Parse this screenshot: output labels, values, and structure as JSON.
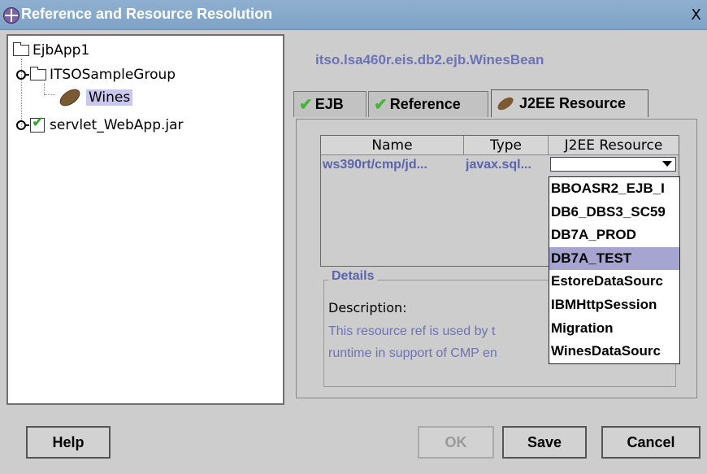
{
  "window": {
    "title": "Reference and Resource Resolution",
    "close_label": "X"
  },
  "tree": {
    "items": [
      {
        "label": "EjbApp1"
      },
      {
        "label": "ITSOSampleGroup"
      },
      {
        "label": "Wines"
      },
      {
        "label": "servlet_WebApp.jar"
      }
    ]
  },
  "bean_name": "itso.lsa460r.eis.db2.ejb.WinesBean",
  "tabs": [
    {
      "label": "EJB"
    },
    {
      "label": "Reference"
    },
    {
      "label": "J2EE Resource"
    }
  ],
  "table": {
    "columns": [
      "Name",
      "Type",
      "J2EE Resource"
    ],
    "rows": [
      {
        "name": "ws390rt/cmp/jd...",
        "type": "javax.sql...",
        "resource": ""
      }
    ]
  },
  "dropdown": {
    "options": [
      "BBOASR2_EJB_I",
      "DB6_DBS3_SC59",
      "DB7A_PROD",
      "DB7A_TEST",
      "EstoreDataSourc",
      "IBMHttpSession",
      "Migration",
      "WinesDataSourc"
    ],
    "selected": "DB7A_TEST"
  },
  "details": {
    "title": "Details",
    "description_label": "Description:",
    "line1": "This resource ref is used by t",
    "line2": "runtime in support of CMP en"
  },
  "buttons": {
    "help": "Help",
    "ok": "OK",
    "save": "Save",
    "cancel": "Cancel"
  }
}
